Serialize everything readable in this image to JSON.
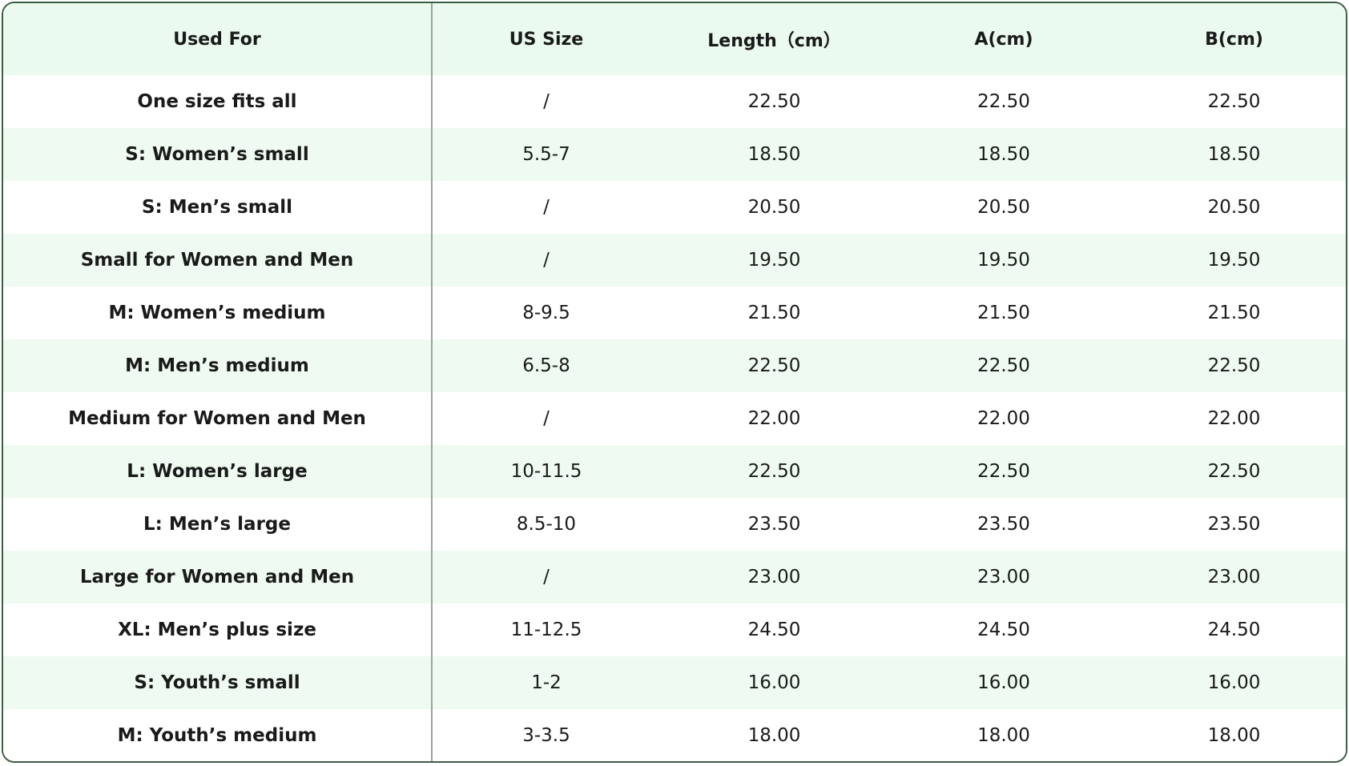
{
  "table": {
    "headers": [
      "Used For",
      "US Size",
      "Length（cm）",
      "A(cm)",
      "B(cm)"
    ],
    "rows": [
      [
        "One size fits all",
        "/",
        "22.50",
        "22.50",
        "22.50"
      ],
      [
        "S: Women’s small",
        "5.5-7",
        "18.50",
        "18.50",
        "18.50"
      ],
      [
        "S: Men’s small",
        "/",
        "20.50",
        "20.50",
        "20.50"
      ],
      [
        "Small for Women and Men",
        "/",
        "19.50",
        "19.50",
        "19.50"
      ],
      [
        "M: Women’s medium",
        "8-9.5",
        "21.50",
        "21.50",
        "21.50"
      ],
      [
        "M: Men’s medium",
        "6.5-8",
        "22.50",
        "22.50",
        "22.50"
      ],
      [
        "Medium for Women and Men",
        "/",
        "22.00",
        "22.00",
        "22.00"
      ],
      [
        "L: Women’s large",
        "10-11.5",
        "22.50",
        "22.50",
        "22.50"
      ],
      [
        "L: Men’s large",
        "8.5-10",
        "23.50",
        "23.50",
        "23.50"
      ],
      [
        "Large for Women and Men",
        "/",
        "23.00",
        "23.00",
        "23.00"
      ],
      [
        "XL: Men’s plus size",
        "11-12.5",
        "24.50",
        "24.50",
        "24.50"
      ],
      [
        "S: Youth’s small",
        "1-2",
        "16.00",
        "16.00",
        "16.00"
      ],
      [
        "M: Youth’s medium",
        "3-3.5",
        "18.00",
        "18.00",
        "18.00"
      ]
    ]
  },
  "colors": {
    "border": "#3b5e45",
    "header_background": "#eafaee",
    "stripe_background": "#effbf1",
    "divider": "#9aa49d"
  }
}
